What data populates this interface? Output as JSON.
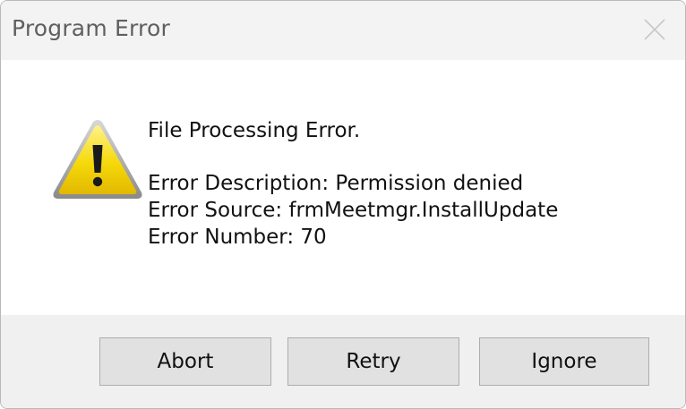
{
  "dialog": {
    "title": "Program Error",
    "close_icon": "close-icon",
    "warning_icon": "warning-triangle-icon",
    "message": {
      "heading": "File Processing Error.",
      "description": "Error Description: Permission denied",
      "source": "Error Source: frmMeetmgr.InstallUpdate",
      "number": "Error Number: 70"
    },
    "buttons": {
      "abort": "Abort",
      "retry": "Retry",
      "ignore": "Ignore"
    }
  },
  "colors": {
    "title_bar": "#f3f3f3",
    "footer": "#f0f0f0",
    "button_face": "#e1e1e1",
    "warning_fill": "#f5d90a"
  }
}
